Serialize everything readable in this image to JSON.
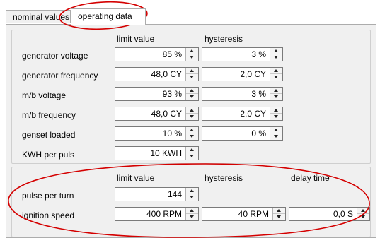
{
  "tabs": [
    {
      "label": "nominal values",
      "active": false
    },
    {
      "label": "operating data",
      "active": true
    }
  ],
  "group1": {
    "col_limit": "limit value",
    "col_hysteresis": "hysteresis",
    "rows": [
      {
        "label": "generator voltage",
        "limit": "85 %",
        "hysteresis": "3 %"
      },
      {
        "label": "generator frequency",
        "limit": "48,0 CY",
        "hysteresis": "2,0 CY"
      },
      {
        "label": "m/b voltage",
        "limit": "93 %",
        "hysteresis": "3 %"
      },
      {
        "label": "m/b frequency",
        "limit": "48,0 CY",
        "hysteresis": "2,0 CY"
      },
      {
        "label": "genset loaded",
        "limit": "10 %",
        "hysteresis": "0 %"
      },
      {
        "label": "KWH per puls",
        "limit": "10 KWH"
      }
    ]
  },
  "group2": {
    "col_limit": "limit value",
    "col_hysteresis": "hysteresis",
    "col_delay": "delay time",
    "rows": [
      {
        "label": "pulse per turn",
        "limit": "144"
      },
      {
        "label": "ignition speed",
        "limit": "400 RPM",
        "hysteresis": "40 RPM",
        "delay": "0,0 S"
      }
    ]
  },
  "annotation_color": "#d40000"
}
